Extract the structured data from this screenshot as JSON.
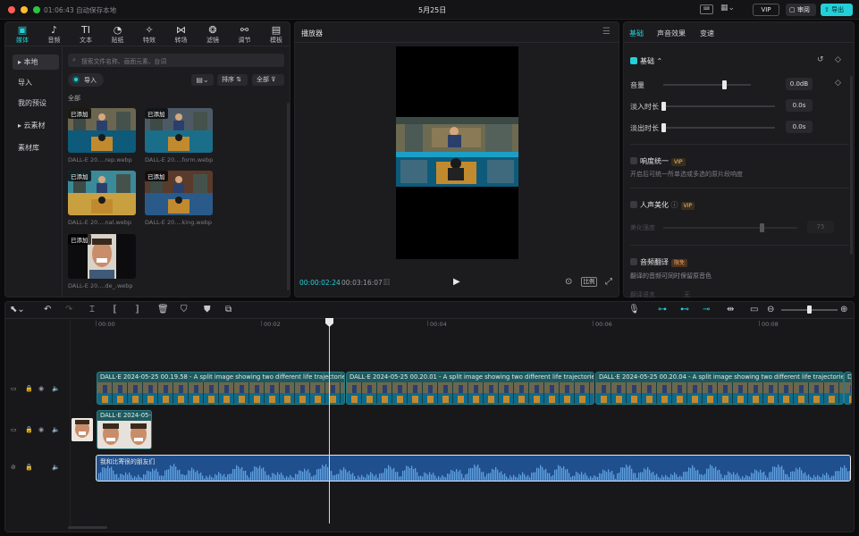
{
  "titlebar": {
    "save_status": "01:06:43 自动保存本地",
    "date": "5月25日",
    "vip_label": "VIP",
    "review_label": "审阅",
    "export_label": "导出"
  },
  "toolbar": {
    "tabs": [
      {
        "label": "媒体",
        "icon": "media-icon",
        "glyph": "▣"
      },
      {
        "label": "音频",
        "icon": "audio-icon",
        "glyph": "♪"
      },
      {
        "label": "文本",
        "icon": "text-icon",
        "glyph": "TI"
      },
      {
        "label": "贴纸",
        "icon": "sticker-icon",
        "glyph": "◔"
      },
      {
        "label": "特效",
        "icon": "effects-icon",
        "glyph": "✧"
      },
      {
        "label": "转场",
        "icon": "transition-icon",
        "glyph": "⋈"
      },
      {
        "label": "滤镜",
        "icon": "filter-icon",
        "glyph": "❂"
      },
      {
        "label": "调节",
        "icon": "adjust-icon",
        "glyph": "⚯"
      },
      {
        "label": "模板",
        "icon": "template-icon",
        "glyph": "▤"
      }
    ]
  },
  "sidebar": {
    "items": [
      {
        "label": "▸ 本地"
      },
      {
        "label": "导入"
      },
      {
        "label": "我的预设"
      },
      {
        "label": "▸ 云素材"
      },
      {
        "label": "素材库"
      }
    ]
  },
  "media_panel": {
    "search_placeholder": "搜索文件名称、画面元素、台词",
    "import_label": "导入",
    "sort_label": "排序",
    "filter_label": "全部",
    "section_label": "全部",
    "items": [
      {
        "badge": "已添加",
        "caption": "DALL-E 20....rep.webp"
      },
      {
        "badge": "已添加",
        "caption": "DALL-E 20....form.webp"
      },
      {
        "badge": "已添加",
        "caption": "DALL-E 20....nal.webp"
      },
      {
        "badge": "已添加",
        "caption": "DALL-E 20....king.webp"
      },
      {
        "badge": "已添加",
        "caption": "DALL-E 20....de_.webp"
      }
    ]
  },
  "player": {
    "title": "播放器",
    "current_time": "00:00:02:24",
    "total_time": "00:03:16:07",
    "ratio_label": "比例"
  },
  "properties": {
    "tabs": [
      "基础",
      "声音效果",
      "变速"
    ],
    "basic_header": "基础",
    "volume_label": "音量",
    "volume_value": "0.0dB",
    "volume_level": 0.5,
    "fadein_label": "淡入时长",
    "fadein_value": "0.0s",
    "fadeout_label": "淡出时长",
    "fadeout_value": "0.0s",
    "loudness_label": "响度统一",
    "loudness_desc": "开启后可统一所单选或多选的原片段响度",
    "vocal_label": "人声美化",
    "vocal_strength_label": "美化强度",
    "vocal_strength_value": "75",
    "translate_label": "音频翻译",
    "translate_badge": "限免",
    "translate_desc": "翻译的音频可同时保留原音色",
    "translate_lang_label": "翻译语言",
    "translate_lang_value": "无",
    "vip_badge": "VIP"
  },
  "timeline": {
    "ruler": [
      "00:00",
      "00:02",
      "00:04",
      "00:06",
      "00:08"
    ],
    "video_clips": [
      {
        "label": "DALL·E 2024-05-25 00.19.58 - A split image showing two different life trajectories. Top half"
      },
      {
        "label": "DALL·E 2024-05-25 00.20.01 - A split image showing two different life trajectories. Top half"
      },
      {
        "label": "DALL·E 2024-05-25 00.20.04 - A split image showing two different life trajectories. Top half"
      },
      {
        "label": "D"
      }
    ],
    "overlay_clip_label": "DALL·E 2024-05-",
    "audio_clip_label": "我和比寄很的朋友们"
  },
  "colors": {
    "accent": "#23d0d8",
    "clip_teal": "#1d5a5e",
    "audio_blue": "#1f4f8c"
  }
}
